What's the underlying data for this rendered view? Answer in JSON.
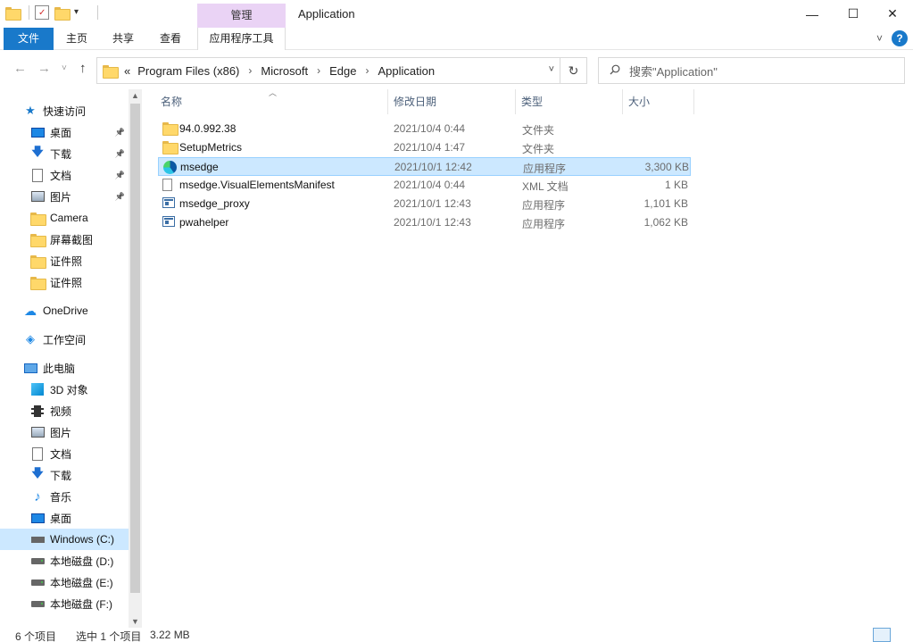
{
  "window": {
    "title": "Application",
    "contextual_tab_group": "管理",
    "minimize_glyph": "—",
    "maximize_glyph": "☐",
    "close_glyph": "✕"
  },
  "ribbon": {
    "tabs": [
      "文件",
      "主页",
      "共享",
      "查看",
      "应用程序工具"
    ],
    "collapse_glyph": "˅",
    "help_glyph": "?"
  },
  "address": {
    "prefix": "«",
    "crumbs": [
      "Program Files (x86)",
      "Microsoft",
      "Edge",
      "Application"
    ],
    "separator": "›",
    "dropdown_glyph": "˅",
    "refresh_glyph": "↻"
  },
  "nav_buttons": {
    "back": "←",
    "forward": "→",
    "recent": "˅",
    "up": "↑"
  },
  "search": {
    "placeholder": "搜索\"Application\""
  },
  "colors": {
    "accent": "#1979ca",
    "selection": "#cce8ff",
    "selection_border": "#99d1ff",
    "contextual": "#ead3f5"
  },
  "navpane": {
    "items": [
      {
        "label": "快速访问",
        "icon": "star-icon",
        "pinned": false
      },
      {
        "label": "桌面",
        "icon": "desktop-icon",
        "pinned": true
      },
      {
        "label": "下载",
        "icon": "download-icon",
        "pinned": true
      },
      {
        "label": "文档",
        "icon": "document-icon",
        "pinned": true
      },
      {
        "label": "图片",
        "icon": "picture-icon",
        "pinned": true
      },
      {
        "label": "Camera",
        "icon": "folder-icon",
        "pinned": false
      },
      {
        "label": "屏幕截图",
        "icon": "folder-icon",
        "pinned": false
      },
      {
        "label": "证件照",
        "icon": "folder-icon",
        "pinned": false
      },
      {
        "label": "证件照",
        "icon": "folder-icon",
        "pinned": false
      },
      {
        "label": "OneDrive",
        "icon": "cloud-icon",
        "pinned": false
      },
      {
        "label": "工作空间",
        "icon": "workspace-icon",
        "pinned": false
      },
      {
        "label": "此电脑",
        "icon": "computer-icon",
        "pinned": false
      },
      {
        "label": "3D 对象",
        "icon": "3d-objects-icon",
        "pinned": false
      },
      {
        "label": "视频",
        "icon": "video-icon",
        "pinned": false
      },
      {
        "label": "图片",
        "icon": "picture-icon",
        "pinned": false
      },
      {
        "label": "文档",
        "icon": "document-icon",
        "pinned": false
      },
      {
        "label": "下载",
        "icon": "download-icon",
        "pinned": false
      },
      {
        "label": "音乐",
        "icon": "music-icon",
        "pinned": false
      },
      {
        "label": "桌面",
        "icon": "desktop-icon",
        "pinned": false
      },
      {
        "label": "Windows (C:)",
        "icon": "system-drive-icon",
        "pinned": false,
        "selected": true
      },
      {
        "label": "本地磁盘 (D:)",
        "icon": "drive-icon",
        "pinned": false
      },
      {
        "label": "本地磁盘 (E:)",
        "icon": "drive-icon",
        "pinned": false
      },
      {
        "label": "本地磁盘 (F:)",
        "icon": "drive-icon",
        "pinned": false
      }
    ],
    "scroll_up": "▲",
    "scroll_down": "▼"
  },
  "columns": [
    "名称",
    "修改日期",
    "类型",
    "大小"
  ],
  "files": [
    {
      "name": "94.0.992.38",
      "date": "2021/10/4 0:44",
      "type": "文件夹",
      "size": "",
      "icon": "folder-icon"
    },
    {
      "name": "SetupMetrics",
      "date": "2021/10/4 1:47",
      "type": "文件夹",
      "size": "",
      "icon": "folder-icon"
    },
    {
      "name": "msedge",
      "date": "2021/10/1 12:42",
      "type": "应用程序",
      "size": "3,300 KB",
      "icon": "edge-icon",
      "selected": true
    },
    {
      "name": "msedge.VisualElementsManifest",
      "date": "2021/10/4 0:44",
      "type": "XML 文档",
      "size": "1 KB",
      "icon": "manifest-icon"
    },
    {
      "name": "msedge_proxy",
      "date": "2021/10/1 12:43",
      "type": "应用程序",
      "size": "1,101 KB",
      "icon": "exe-icon"
    },
    {
      "name": "pwahelper",
      "date": "2021/10/1 12:43",
      "type": "应用程序",
      "size": "1,062 KB",
      "icon": "exe-icon"
    }
  ],
  "status": {
    "item_count": "6 个项目",
    "selection": "选中 1 个项目",
    "selection_size": "3.22 MB"
  }
}
